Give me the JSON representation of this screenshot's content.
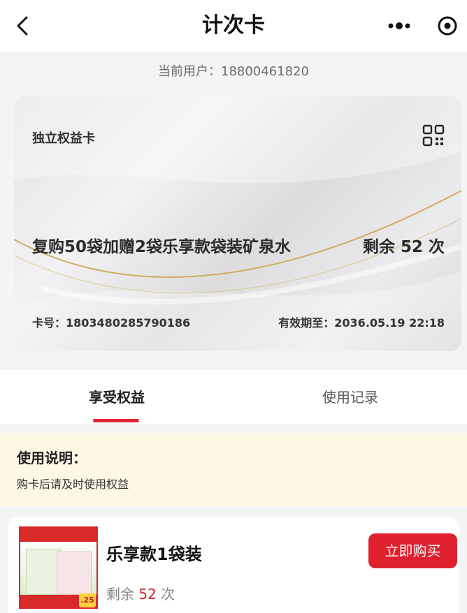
{
  "nav": {
    "title": "计次卡",
    "back_icon": "chevron-left-icon",
    "more_icon": "more-dots-icon",
    "target_icon": "target-icon"
  },
  "user": {
    "label": "当前用户：",
    "phone": "18800461820"
  },
  "card": {
    "type": "独立权益卡",
    "qr_icon": "qr-code-icon",
    "name": "复购50袋加赠2袋乐享款袋装矿泉水",
    "remain_prefix": "剩余",
    "remain_count": "52",
    "remain_suffix": "次",
    "card_no_label": "卡号：",
    "card_no": "1803480285790186",
    "expire_label": "有效期至：",
    "expire": "2036.05.19 22:18"
  },
  "tabs": [
    {
      "label": "享受权益",
      "active": true
    },
    {
      "label": "使用记录",
      "active": false
    }
  ],
  "notice": {
    "title": "使用说明：",
    "text": "购卡后请及时使用权益"
  },
  "product": {
    "name": "乐享款1袋装",
    "remain_prefix": "剩余",
    "remain_count": "52",
    "remain_suffix": "次",
    "buy_label": "立即购买",
    "image_badge": ".25"
  },
  "colors": {
    "accent": "#e0202e",
    "notice_bg": "#fdf7e6",
    "card_gold": "#c9a24a",
    "page_bg": "#f4f4f4"
  }
}
